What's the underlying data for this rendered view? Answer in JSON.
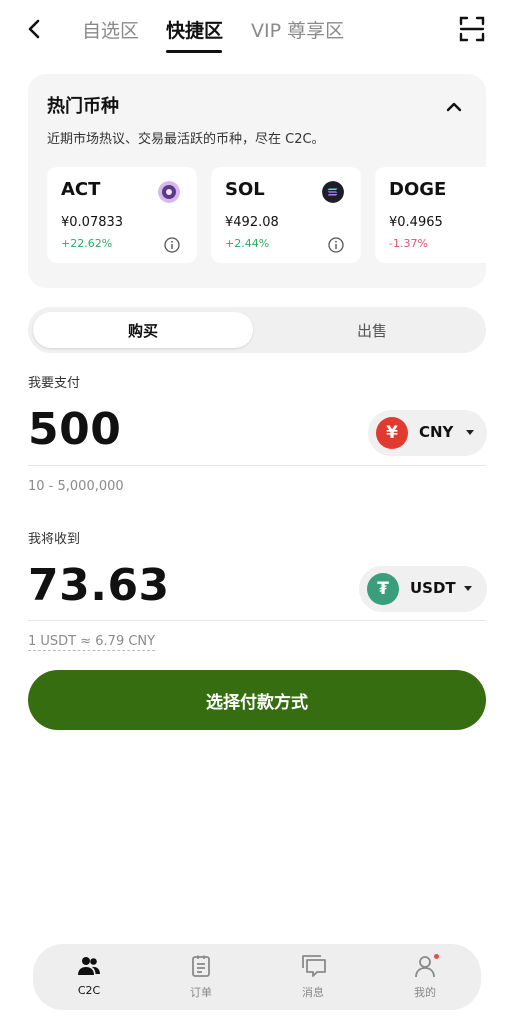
{
  "header": {
    "tabs": [
      {
        "label": "自选区"
      },
      {
        "label": "快捷区"
      },
      {
        "label": "VIP 尊享区"
      }
    ],
    "active_tab": 1
  },
  "hot": {
    "title": "热门币种",
    "description": "近期市场热议、交易最活跃的币种，尽在 C2C。",
    "coins": [
      {
        "symbol": "ACT",
        "price": "¥0.07833",
        "change": "+22.62%",
        "direction": "up",
        "logo_color": "#c9a2e6"
      },
      {
        "symbol": "SOL",
        "price": "¥492.08",
        "change": "+2.44%",
        "direction": "up",
        "logo_color": "#222233"
      },
      {
        "symbol": "DOGE",
        "price": "¥0.4965",
        "change": "-1.37%",
        "direction": "down",
        "logo_color": "#c2a633"
      }
    ]
  },
  "trade": {
    "buy_label": "购买",
    "sell_label": "出售",
    "pay_label": "我要支付",
    "pay_amount": "500",
    "pay_currency": "CNY",
    "pay_currency_symbol": "¥",
    "pay_range": "10 - 5,000,000",
    "receive_label": "我将收到",
    "receive_amount": "73.63",
    "receive_currency": "USDT",
    "receive_currency_symbol": "₮",
    "rate": "1 USDT ≈ 6.79 CNY",
    "submit_label": "选择付款方式"
  },
  "nav": {
    "items": [
      {
        "label": "C2C",
        "icon": "users-icon",
        "active": true
      },
      {
        "label": "订单",
        "icon": "clipboard-icon",
        "active": false
      },
      {
        "label": "消息",
        "icon": "chat-icon",
        "active": false
      },
      {
        "label": "我的",
        "icon": "profile-icon",
        "active": false,
        "badge": true
      }
    ]
  },
  "colors": {
    "primary_green": "#356d10",
    "up": "#2bae5e",
    "down": "#e5526f",
    "cny_red": "#e03b2e",
    "usdt_green": "#3a9d7b"
  }
}
